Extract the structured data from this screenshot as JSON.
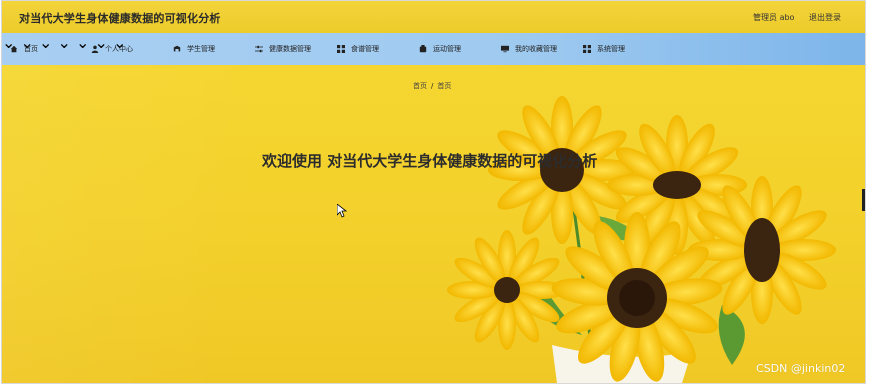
{
  "header": {
    "app_title": "对当代大学生身体健康数据的可视化分析",
    "admin_label": "管理员 abo",
    "logout_label": "退出登录"
  },
  "nav": {
    "items": [
      {
        "label": "首页",
        "icon": "home-icon"
      },
      {
        "label": "个人中心",
        "icon": "user-icon"
      },
      {
        "label": "学生管理",
        "icon": "student-icon"
      },
      {
        "label": "健康数据管理",
        "icon": "sliders-icon"
      },
      {
        "label": "食谱管理",
        "icon": "grid-icon"
      },
      {
        "label": "运动管理",
        "icon": "sport-icon"
      },
      {
        "label": "我的收藏管理",
        "icon": "monitor-icon"
      },
      {
        "label": "系统管理",
        "icon": "grid-icon"
      }
    ]
  },
  "breadcrumb": {
    "root": "首页",
    "separator": "/",
    "current": "首页"
  },
  "main": {
    "welcome": "欢迎使用 对当代大学生身体健康数据的可视化分析"
  },
  "watermark": "CSDN @jinkin02",
  "colors": {
    "background": "#f2d02e",
    "nav": "#a8cff2",
    "text": "#2c2c2c"
  }
}
